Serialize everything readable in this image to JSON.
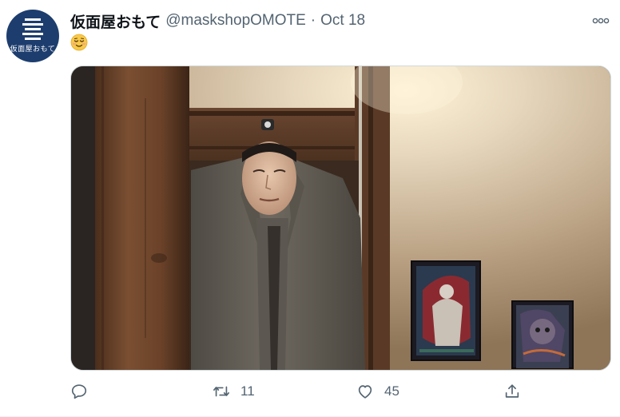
{
  "tweet": {
    "display_name": "仮面屋おもて",
    "handle": "@maskshopOMOTE",
    "separator": "·",
    "date": "Oct 18",
    "emoji": "relieved-smiling-face",
    "avatar_text": "仮面屋おもて"
  },
  "actions": {
    "reply_count": "",
    "retweet_count": "11",
    "like_count": "45"
  },
  "colors": {
    "text_primary": "#0f1419",
    "text_secondary": "#536471",
    "avatar_bg": "#1d3d6e",
    "border": "#cfd9de"
  }
}
